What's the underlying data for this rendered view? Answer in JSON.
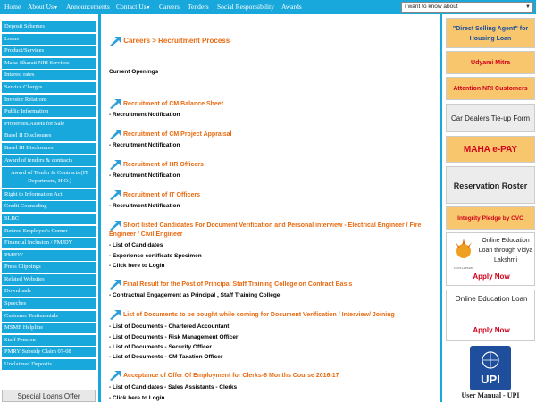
{
  "nav": {
    "items": [
      "Home",
      "About Us",
      "Announcements",
      "Contact Us",
      "Careers",
      "Tenders",
      "Social Responsibility",
      "Awards"
    ],
    "caret": "▼",
    "select_value": "I want to know about",
    "select_arrow": "▼"
  },
  "sidebar": {
    "items": [
      "Deposit Schemes",
      "Loans",
      "Product/Services",
      "Maha-Bharati NRI Services",
      "Interest rates",
      "Service Charges",
      "Investor Relations",
      "Public Information",
      "Properties/Assets for Sale",
      "Basel II Disclosures",
      "Basel III Disclosures",
      "Award of tenders & contracts",
      "Award of Tender & Contracts (IT Department, H.O.)",
      "Right to Information Act",
      "Credit Counseling",
      "SLBC",
      "Retired Employee's Corner",
      "Financial Inclusion / PMJDY",
      "PMJDY",
      "Press Clippings",
      "Related Websites",
      "Downloads",
      "Speeches",
      "Customer Testimonials",
      "MSME Helpline",
      "Staff Pension",
      "PMRY Subsidy Claim 07-08",
      "Unclaimed Deposits"
    ],
    "offer": "Special Loans Offer"
  },
  "main": {
    "breadcrumb": "Careers > Recruitment Process",
    "current": "Current Openings",
    "sections": [
      {
        "title": "Recruitment of CM Balance Sheet",
        "lines": [
          "- Recruitment Notification"
        ]
      },
      {
        "title": "Recruitment of CM Project Appraisal",
        "lines": [
          "- Recruitment Notification"
        ]
      },
      {
        "title": "Recruitment of HR Officers",
        "lines": [
          "- Recruitment Notification"
        ]
      },
      {
        "title": "Recruitment of IT Officers",
        "lines": [
          "- Recruitment Notification"
        ]
      },
      {
        "title": "Short listed Candidates For Document Verification and Personal interview - Electrical Engineer / Fire Engineer / Civil Engineer",
        "lines": [
          "- List of Candidates",
          "- Experience certificate Specimen",
          "- Click here to Login"
        ]
      },
      {
        "title": "Final Result for the Post of Principal Staff Training College on Contract Basis",
        "lines": [
          "- Contractual Engagement as Principal , Staff Training College"
        ]
      },
      {
        "title": "List of Documents to be bought while coming for Document Verification / Interview/ Joining",
        "lines": [
          "- List of Documents - Chartered Accountant",
          "- List of Documents - Risk Management Officer",
          "- List of Documents - Security Officer",
          "- List of Documents - CM Taxation Officer"
        ]
      },
      {
        "title": "Acceptance of Offer Of Employment for Clerks-6 Months Course 2016-17",
        "lines": [
          "- List of Candidates - Sales Assistants - Clerks",
          "- Click here to Login"
        ]
      }
    ]
  },
  "right": {
    "dsa": "\"Direct Selling Agent\" for Housing Loan",
    "udyami": "Udyami Mitra",
    "nri": "Attention NRI Customers",
    "cardealers": "Car Dealers Tie-up Form",
    "mahapay": "MAHA e-PAY",
    "roster": "Reservation Roster",
    "pledge": "Integrity Pledge by CVC",
    "vidya_logo": "VIDYA LAKSHMI",
    "vidya_text": "Online Education Loan through Vidya Lakshmi",
    "vidya_apply": "Apply Now",
    "edu_text": "Online Education Loan",
    "edu_apply": "Apply Now",
    "upi_logo": "UPI",
    "upi_text": "User Manual - UPI"
  },
  "colors": {
    "nav": "#19a8dc",
    "heading": "#e86a10",
    "orange_box": "#f8c66c",
    "red": "#d0021b"
  }
}
